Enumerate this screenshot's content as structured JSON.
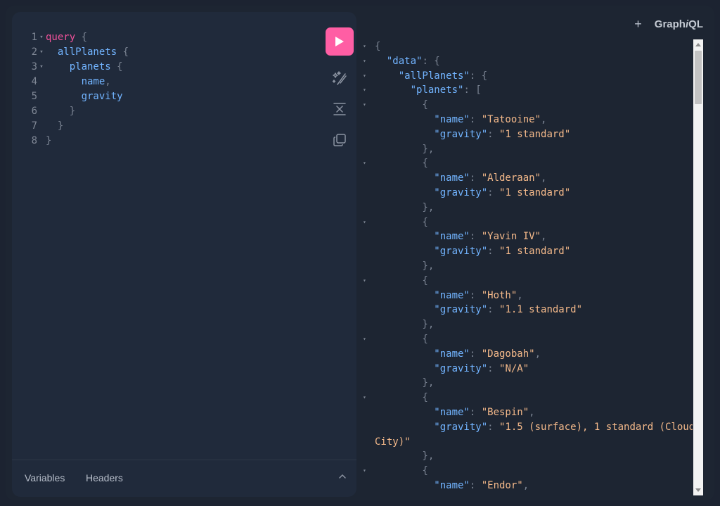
{
  "brand": {
    "prefix": "Graph",
    "italic": "i",
    "suffix": "QL"
  },
  "header": {
    "add_tab_label": "+"
  },
  "query": {
    "lines": [
      {
        "n": "1",
        "tokens": [
          {
            "t": "query",
            "c": "kw"
          },
          {
            "t": " {",
            "c": "pn"
          }
        ],
        "fold": true
      },
      {
        "n": "2",
        "tokens": [
          {
            "t": "  allPlanets",
            "c": "fld"
          },
          {
            "t": " {",
            "c": "pn"
          }
        ],
        "fold": true
      },
      {
        "n": "3",
        "tokens": [
          {
            "t": "    planets",
            "c": "fld"
          },
          {
            "t": " {",
            "c": "pn"
          }
        ],
        "fold": true
      },
      {
        "n": "4",
        "tokens": [
          {
            "t": "      name",
            "c": "fld"
          },
          {
            "t": ",",
            "c": "pn"
          }
        ],
        "fold": false
      },
      {
        "n": "5",
        "tokens": [
          {
            "t": "      gravity",
            "c": "fld"
          }
        ],
        "fold": false
      },
      {
        "n": "6",
        "tokens": [
          {
            "t": "    }",
            "c": "pn"
          }
        ],
        "fold": false
      },
      {
        "n": "7",
        "tokens": [
          {
            "t": "  }",
            "c": "pn"
          }
        ],
        "fold": false
      },
      {
        "n": "8",
        "tokens": [
          {
            "t": "}",
            "c": "pn"
          }
        ],
        "fold": false
      }
    ]
  },
  "tools": {
    "run": "play-icon",
    "prettify": "magic-wand-icon",
    "merge": "merge-icon",
    "copy": "copy-icon"
  },
  "bottom_tabs": {
    "variables": "Variables",
    "headers": "Headers"
  },
  "result": {
    "lines": [
      {
        "fold": true,
        "tokens": [
          {
            "t": "{",
            "c": "p"
          }
        ]
      },
      {
        "fold": true,
        "tokens": [
          {
            "t": "  \"data\"",
            "c": "key"
          },
          {
            "t": ": {",
            "c": "p"
          }
        ]
      },
      {
        "fold": true,
        "tokens": [
          {
            "t": "    \"allPlanets\"",
            "c": "key"
          },
          {
            "t": ": {",
            "c": "p"
          }
        ]
      },
      {
        "fold": true,
        "tokens": [
          {
            "t": "      \"planets\"",
            "c": "key"
          },
          {
            "t": ": [",
            "c": "p"
          }
        ]
      },
      {
        "fold": true,
        "tokens": [
          {
            "t": "        {",
            "c": "p"
          }
        ]
      },
      {
        "fold": false,
        "tokens": [
          {
            "t": "          \"name\"",
            "c": "key"
          },
          {
            "t": ": ",
            "c": "p"
          },
          {
            "t": "\"Tatooine\"",
            "c": "str"
          },
          {
            "t": ",",
            "c": "p"
          }
        ]
      },
      {
        "fold": false,
        "tokens": [
          {
            "t": "          \"gravity\"",
            "c": "key"
          },
          {
            "t": ": ",
            "c": "p"
          },
          {
            "t": "\"1 standard\"",
            "c": "str"
          }
        ]
      },
      {
        "fold": false,
        "tokens": [
          {
            "t": "        },",
            "c": "p"
          }
        ]
      },
      {
        "fold": true,
        "tokens": [
          {
            "t": "        {",
            "c": "p"
          }
        ]
      },
      {
        "fold": false,
        "tokens": [
          {
            "t": "          \"name\"",
            "c": "key"
          },
          {
            "t": ": ",
            "c": "p"
          },
          {
            "t": "\"Alderaan\"",
            "c": "str"
          },
          {
            "t": ",",
            "c": "p"
          }
        ]
      },
      {
        "fold": false,
        "tokens": [
          {
            "t": "          \"gravity\"",
            "c": "key"
          },
          {
            "t": ": ",
            "c": "p"
          },
          {
            "t": "\"1 standard\"",
            "c": "str"
          }
        ]
      },
      {
        "fold": false,
        "tokens": [
          {
            "t": "        },",
            "c": "p"
          }
        ]
      },
      {
        "fold": true,
        "tokens": [
          {
            "t": "        {",
            "c": "p"
          }
        ]
      },
      {
        "fold": false,
        "tokens": [
          {
            "t": "          \"name\"",
            "c": "key"
          },
          {
            "t": ": ",
            "c": "p"
          },
          {
            "t": "\"Yavin IV\"",
            "c": "str"
          },
          {
            "t": ",",
            "c": "p"
          }
        ]
      },
      {
        "fold": false,
        "tokens": [
          {
            "t": "          \"gravity\"",
            "c": "key"
          },
          {
            "t": ": ",
            "c": "p"
          },
          {
            "t": "\"1 standard\"",
            "c": "str"
          }
        ]
      },
      {
        "fold": false,
        "tokens": [
          {
            "t": "        },",
            "c": "p"
          }
        ]
      },
      {
        "fold": true,
        "tokens": [
          {
            "t": "        {",
            "c": "p"
          }
        ]
      },
      {
        "fold": false,
        "tokens": [
          {
            "t": "          \"name\"",
            "c": "key"
          },
          {
            "t": ": ",
            "c": "p"
          },
          {
            "t": "\"Hoth\"",
            "c": "str"
          },
          {
            "t": ",",
            "c": "p"
          }
        ]
      },
      {
        "fold": false,
        "tokens": [
          {
            "t": "          \"gravity\"",
            "c": "key"
          },
          {
            "t": ": ",
            "c": "p"
          },
          {
            "t": "\"1.1 standard\"",
            "c": "str"
          }
        ]
      },
      {
        "fold": false,
        "tokens": [
          {
            "t": "        },",
            "c": "p"
          }
        ]
      },
      {
        "fold": true,
        "tokens": [
          {
            "t": "        {",
            "c": "p"
          }
        ]
      },
      {
        "fold": false,
        "tokens": [
          {
            "t": "          \"name\"",
            "c": "key"
          },
          {
            "t": ": ",
            "c": "p"
          },
          {
            "t": "\"Dagobah\"",
            "c": "str"
          },
          {
            "t": ",",
            "c": "p"
          }
        ]
      },
      {
        "fold": false,
        "tokens": [
          {
            "t": "          \"gravity\"",
            "c": "key"
          },
          {
            "t": ": ",
            "c": "p"
          },
          {
            "t": "\"N/A\"",
            "c": "str"
          }
        ]
      },
      {
        "fold": false,
        "tokens": [
          {
            "t": "        },",
            "c": "p"
          }
        ]
      },
      {
        "fold": true,
        "tokens": [
          {
            "t": "        {",
            "c": "p"
          }
        ]
      },
      {
        "fold": false,
        "tokens": [
          {
            "t": "          \"name\"",
            "c": "key"
          },
          {
            "t": ": ",
            "c": "p"
          },
          {
            "t": "\"Bespin\"",
            "c": "str"
          },
          {
            "t": ",",
            "c": "p"
          }
        ]
      },
      {
        "fold": false,
        "tokens": [
          {
            "t": "          \"gravity\"",
            "c": "key"
          },
          {
            "t": ": ",
            "c": "p"
          },
          {
            "t": "\"1.5 (surface), 1 standard (Cloud",
            "c": "str"
          }
        ]
      },
      {
        "fold": false,
        "cont": true,
        "tokens": [
          {
            "t": "City)\"",
            "c": "str"
          }
        ]
      },
      {
        "fold": false,
        "tokens": [
          {
            "t": "        },",
            "c": "p"
          }
        ]
      },
      {
        "fold": true,
        "tokens": [
          {
            "t": "        {",
            "c": "p"
          }
        ]
      },
      {
        "fold": false,
        "tokens": [
          {
            "t": "          \"name\"",
            "c": "key"
          },
          {
            "t": ": ",
            "c": "p"
          },
          {
            "t": "\"Endor\"",
            "c": "str"
          },
          {
            "t": ",",
            "c": "p"
          }
        ]
      }
    ]
  }
}
